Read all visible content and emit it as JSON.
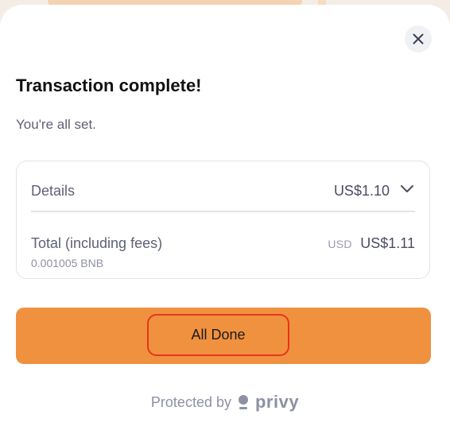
{
  "modal": {
    "title": "Transaction complete!",
    "subtitle": "You're all set.",
    "close_icon": "close-icon"
  },
  "details": {
    "label": "Details",
    "amount": "US$1.10",
    "toggle_icon": "chevron-down-icon",
    "total_label": "Total (including fees)",
    "total_sub": "0.001005 BNB",
    "currency_code": "USD",
    "total_amount": "US$1.11"
  },
  "actions": {
    "done_label": "All Done"
  },
  "footer": {
    "protected_text": "Protected by",
    "brand_icon": "privy-logo-icon",
    "brand": "privy"
  },
  "colors": {
    "accent": "#f0913f",
    "highlight_ring": "#e8341c",
    "muted_text": "#5f6176",
    "border": "#e2e3ea"
  }
}
